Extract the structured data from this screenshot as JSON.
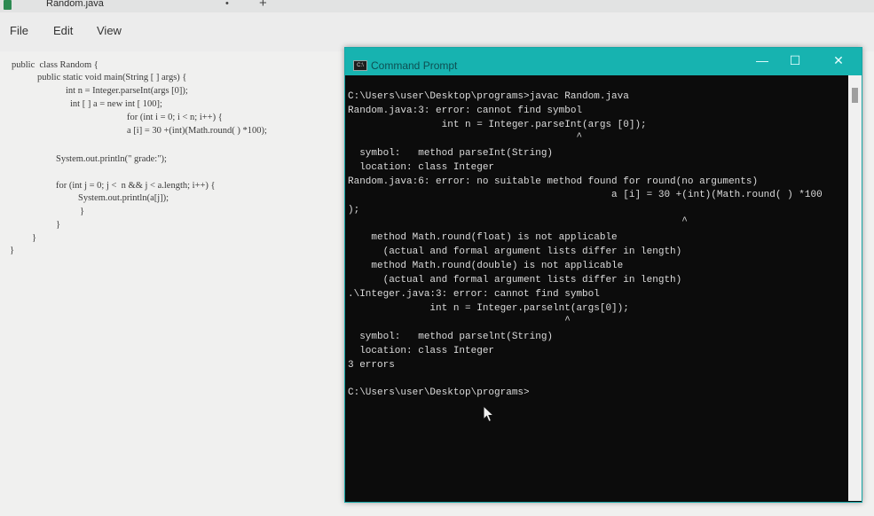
{
  "notepad": {
    "tab_title": "Random.java",
    "tab_modified_marker": "•",
    "new_tab_symbol": "+",
    "menu": [
      "File",
      "Edit",
      "View"
    ],
    "code_lines": [
      "public  class Random {",
      "public static void main(String [ ] args) {",
      "int n = Integer.parseInt(args [0]);",
      "int [ ] a = new int [ 100];",
      "for (int i = 0; i < n; i++) {",
      "a [i] = 30 +(int)(Math.round( ) *100);",
      "System.out.println(\" grade:\");",
      "for (int j = 0; j <  n && j < a.length; i++) {",
      "System.out.println(a[j]);",
      "}",
      "}",
      "}",
      "}"
    ]
  },
  "cmd": {
    "title": "Command Prompt",
    "icon_label": "C:\\",
    "controls": {
      "minimize": "—",
      "maximize": "☐",
      "close": "✕"
    },
    "lines": [
      "C:\\Users\\user\\Desktop\\programs>javac Random.java",
      "Random.java:3: error: cannot find symbol",
      "                int n = Integer.parseInt(args [0]);",
      "                                       ^",
      "  symbol:   method parseInt(String)",
      "  location: class Integer",
      "Random.java:6: error: no suitable method found for round(no arguments)",
      "                                             a [i] = 30 +(int)(Math.round( ) *100",
      ");",
      "                                                         ^",
      "    method Math.round(float) is not applicable",
      "      (actual and formal argument lists differ in length)",
      "    method Math.round(double) is not applicable",
      "      (actual and formal argument lists differ in length)",
      ".\\Integer.java:3: error: cannot find symbol",
      "              int n = Integer.parselnt(args[0]);",
      "                                     ^",
      "  symbol:   method parselnt(String)",
      "  location: class Integer",
      "3 errors",
      "",
      "C:\\Users\\user\\Desktop\\programs>"
    ]
  }
}
